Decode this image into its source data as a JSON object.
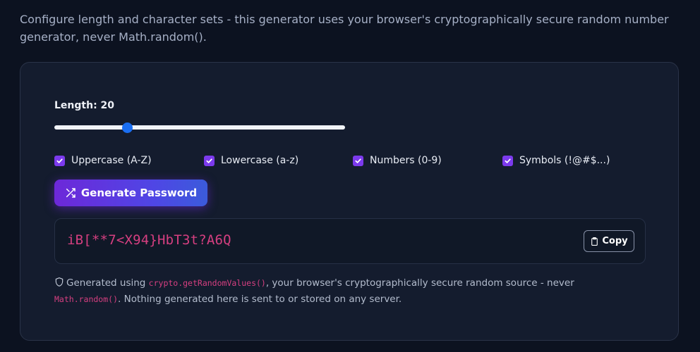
{
  "intro": {
    "text": "Configure length and character sets - this generator uses your browser's cryptographically secure random number generator, never Math.random()."
  },
  "length": {
    "label": "Length: 20",
    "value": 20,
    "fraction": 0.25
  },
  "options": [
    {
      "label": "Uppercase (A-Z)",
      "checked": true
    },
    {
      "label": "Lowercase (a-z)",
      "checked": true
    },
    {
      "label": "Numbers (0-9)",
      "checked": true
    },
    {
      "label": "Symbols (!@#$...)",
      "checked": true
    }
  ],
  "generate": {
    "label": "Generate Password",
    "icon": "shuffle-icon"
  },
  "output": {
    "password": "iB[**7<X94}HbT3t?A6Q",
    "copy_label": "Copy",
    "copy_icon": "clipboard-icon"
  },
  "note": {
    "part1": "Generated using ",
    "code1": "crypto.getRandomValues()",
    "part2": ", your browser's cryptographically secure random source - never ",
    "code2": "Math.random()",
    "part3": ". Nothing generated here is sent to or stored on any server.",
    "icon": "shield-icon"
  },
  "colors": {
    "background": "#0c1220",
    "card": "#141c2e",
    "accent": "#7c3aed",
    "slider_thumb": "#1a6ef2",
    "password": "#d63f80"
  }
}
